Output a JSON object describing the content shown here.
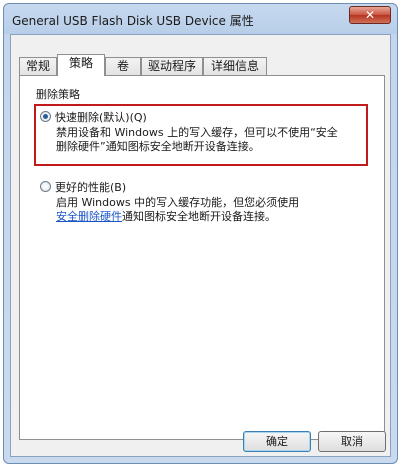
{
  "window": {
    "title": "General USB Flash Disk USB Device 属性",
    "close_glyph": "✕"
  },
  "tabs": [
    {
      "label": "常规"
    },
    {
      "label": "策略"
    },
    {
      "label": "卷"
    },
    {
      "label": "驱动程序"
    },
    {
      "label": "详细信息"
    }
  ],
  "policy": {
    "group_label": "删除策略",
    "quick_removal": {
      "label": "快速删除(默认)(Q)",
      "selected": true,
      "desc_line1": "禁用设备和 Windows 上的写入缓存，但可以不使用“安全",
      "desc_line2": "删除硬件”通知图标安全地断开设备连接。"
    },
    "better_performance": {
      "label": "更好的性能(B)",
      "selected": false,
      "desc_line1": "启用 Windows 中的写入缓存功能，但您必须使用",
      "desc_link": "安全删除硬件",
      "desc_line2_rest": "通知图标安全地断开设备连接。"
    }
  },
  "buttons": {
    "ok": "确定",
    "cancel": "取消"
  },
  "colors": {
    "highlight_border": "#c21a1a",
    "link": "#1a55c8"
  }
}
